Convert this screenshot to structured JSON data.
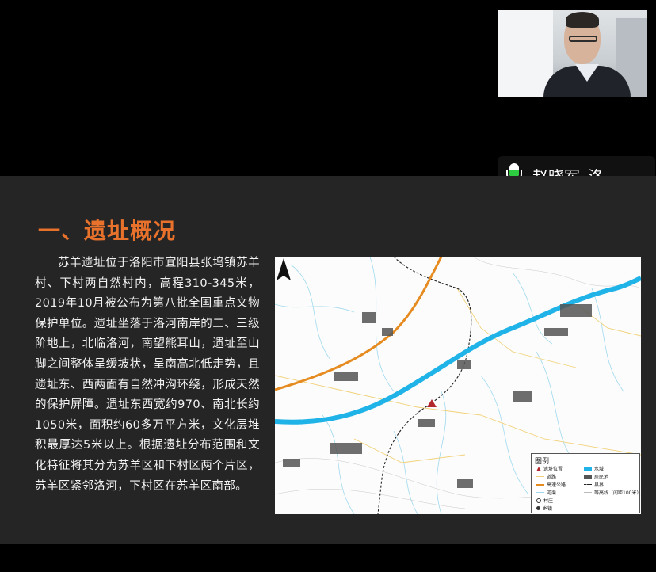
{
  "participant": {
    "name_label": "赵晓军–洛…",
    "mic_level": 0.55
  },
  "slide": {
    "title": "一、遗址概况",
    "body": "苏羊遗址位于洛阳市宜阳县张坞镇苏羊村、下村两自然村内，高程310-345米，2019年10月被公布为第八批全国重点文物保护单位。遗址坐落于洛河南岸的二、三级阶地上，北临洛河，南望熊耳山，遗址至山脚之间整体呈缓坡状，呈南高北低走势，且遗址东、西两面有自然冲沟环绕，形成天然的保护屏障。遗址东西宽约970、南北长约1050米，面积约60多万平方米，文化层堆积最厚达5米以上。根据遗址分布范围和文化特征将其分为苏羊区和下村区两个片区，苏羊区紧邻洛河，下村区在苏羊区南部。"
  },
  "map": {
    "legend": {
      "title": "图例",
      "items": {
        "site": "遗址位置",
        "water": "水域",
        "road": "道路",
        "residential": "居民地",
        "expressway": "高速公路",
        "boundary": "县界",
        "river": "河渠",
        "contour": "等高线（间距100米）",
        "village": "村庄",
        "town": "乡镇"
      }
    },
    "colors": {
      "river": "#1fb3e8",
      "expressway": "#e58b1f",
      "site_marker": "#b3262b",
      "roads": "#f1d27a",
      "streams": "#9fd9ee"
    }
  }
}
